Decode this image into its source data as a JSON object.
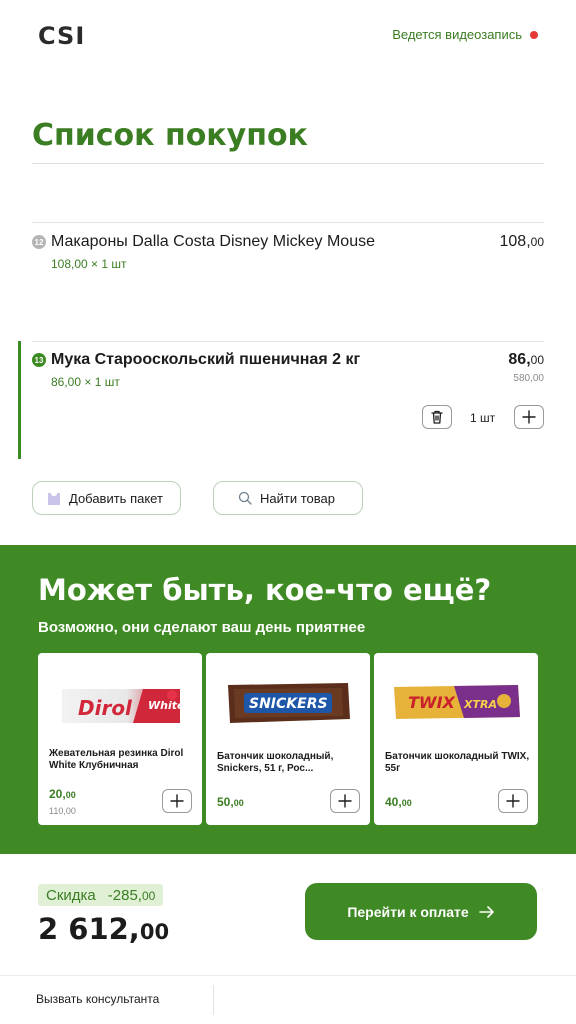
{
  "header": {
    "logo": "CSI",
    "recording_text": "Ведется видеозапись",
    "recording_color": "#e53935"
  },
  "page_title": "Список покупок",
  "items": [
    {
      "index": "12",
      "name": "Макароны Dalla Costa Disney Mickey Mouse",
      "unit_line": "108,00 × 1 шт",
      "price_int": "108,",
      "price_dec": "00"
    },
    {
      "index": "13",
      "name": "Мука Старооскольский пшеничная 2 кг",
      "unit_line": "86,00 × 1 шт",
      "price_int": "86,",
      "price_dec": "00",
      "old_price": "580,00",
      "quantity": "1 шт"
    }
  ],
  "actions": {
    "add_bag": "Добавить пакет",
    "find_item": "Найти товар"
  },
  "promo": {
    "title": "Может быть, кое-что ещё?",
    "subtitle": "Возможно, они сделают ваш день приятнее",
    "background": "#3f8a24",
    "cards": [
      {
        "name": "Жевательная резинка Dirol White Клубничная",
        "price_int": "20,",
        "price_dec": "00",
        "old_price": "110,00",
        "image_text": "Dirol White"
      },
      {
        "name": "Батончик шоколадный, Snickers, 51 г, Рос...",
        "price_int": "50,",
        "price_dec": "00",
        "image_text": "SNICKERS"
      },
      {
        "name": "Батончик шоколадный TWIX, 55г",
        "price_int": "40,",
        "price_dec": "00",
        "image_text": "TWIX XTRA"
      }
    ]
  },
  "summary": {
    "discount_label": "Скидка",
    "discount_int": "-285,",
    "discount_dec": "00",
    "total_int": "2 612,",
    "total_dec": "00",
    "pay_label": "Перейти к оплате"
  },
  "footer": {
    "consultant": "Вызвать консультанта"
  },
  "colors": {
    "accent": "#3b7d23",
    "accent_bg": "#3f8a24"
  }
}
